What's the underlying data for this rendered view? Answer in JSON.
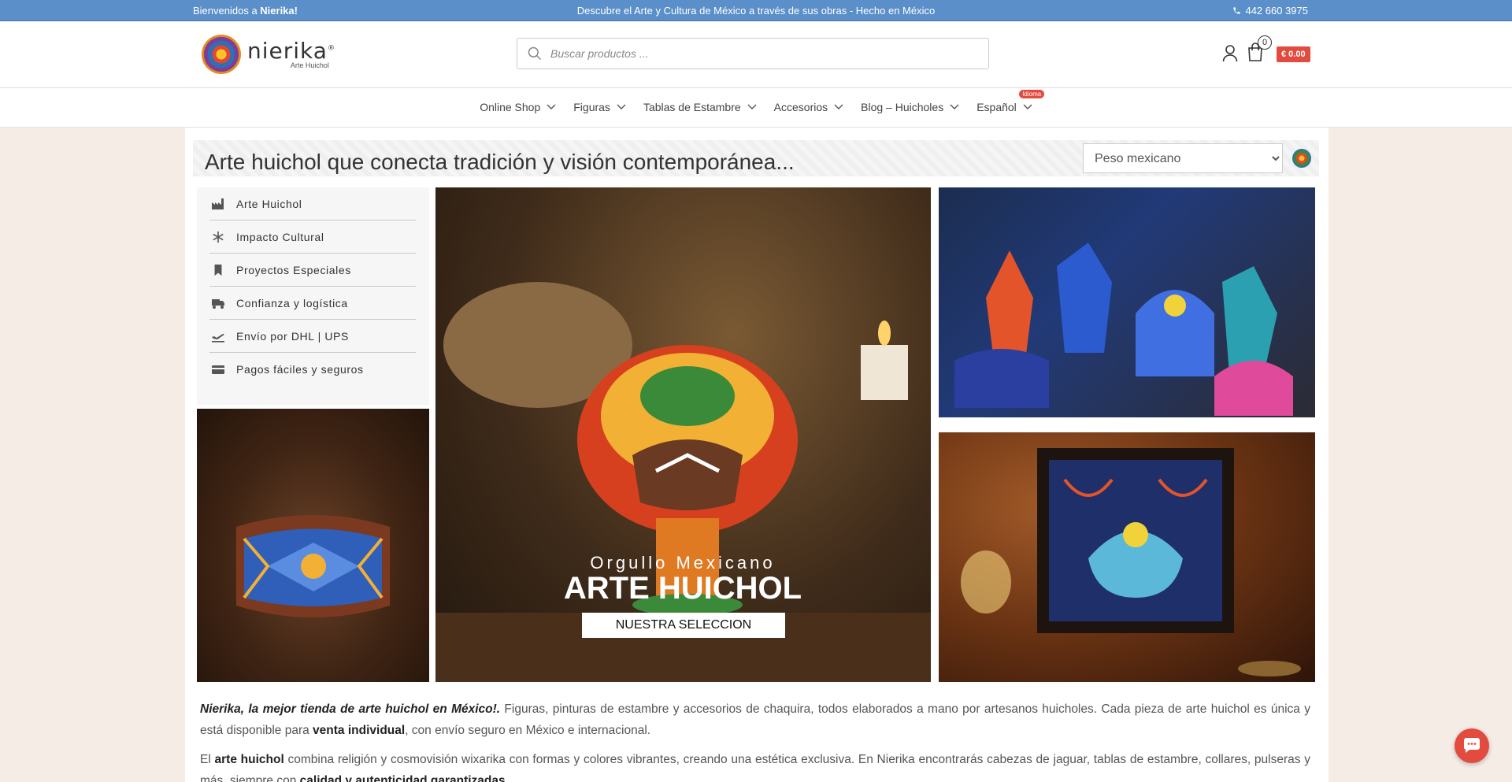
{
  "topbar": {
    "welcome_prefix": "Bienvenidos a ",
    "welcome_brand": "Nierika!",
    "tagline": "Descubre el Arte y Cultura de México a través de sus obras - Hecho en México",
    "phone": "442 660 3975"
  },
  "header": {
    "logo_name": "nierika",
    "logo_registered": "®",
    "logo_sub": "Arte Huichol",
    "search_placeholder": "Buscar productos ...",
    "cart_count": "0",
    "cart_total": "€ 0.00"
  },
  "nav": {
    "items": [
      {
        "label": "Online Shop"
      },
      {
        "label": "Figuras"
      },
      {
        "label": "Tablas de Estambre"
      },
      {
        "label": "Accesorios"
      },
      {
        "label": "Blog – Huicholes"
      },
      {
        "label": "Español",
        "badge": "Idioma"
      }
    ]
  },
  "banner": {
    "title": "Arte huichol que conecta tradición y visión contemporánea...",
    "currency_options": [
      "Peso mexicano"
    ]
  },
  "sidebar": {
    "items": [
      {
        "label": "Arte Huichol",
        "icon": "factory-icon"
      },
      {
        "label": "Impacto Cultural",
        "icon": "snowflake-icon"
      },
      {
        "label": "Proyectos Especiales",
        "icon": "bookmark-icon"
      },
      {
        "label": "Confianza y logística",
        "icon": "truck-icon"
      },
      {
        "label": "Envío por DHL | UPS",
        "icon": "plane-departure-icon"
      },
      {
        "label": "Pagos fáciles y seguros",
        "icon": "credit-card-icon"
      }
    ]
  },
  "hero": {
    "subtitle": "Orgullo Mexicano",
    "title": "ARTE HUICHOL",
    "button": "NUESTRA SELECCION"
  },
  "content": {
    "p1_lead": "Nierika, la mejor tienda de arte huichol en México!.",
    "p1_text_a": " Figuras, pinturas de estambre y accesorios de chaquira, todos elaborados a mano por artesanos huicholes. Cada pieza de arte huichol es única y está disponible para ",
    "p1_bold": "venta individual",
    "p1_text_b": ", con envío seguro en México e internacional.",
    "p2_text_a": "El ",
    "p2_bold_a": "arte huichol",
    "p2_text_b": " combina religión y cosmovisión wixarika con formas y colores vibrantes, creando una estética exclusiva. En Nierika encontrarás cabezas de jaguar, tablas de estambre, collares, pulseras y más, siempre con ",
    "p2_bold_b": "calidad y autenticidad garantizadas",
    "p2_text_c": "."
  },
  "colors": {
    "topbar_bg": "#5b8fc9",
    "accent_red": "#e34b3f",
    "page_bg": "#f5ece6"
  }
}
